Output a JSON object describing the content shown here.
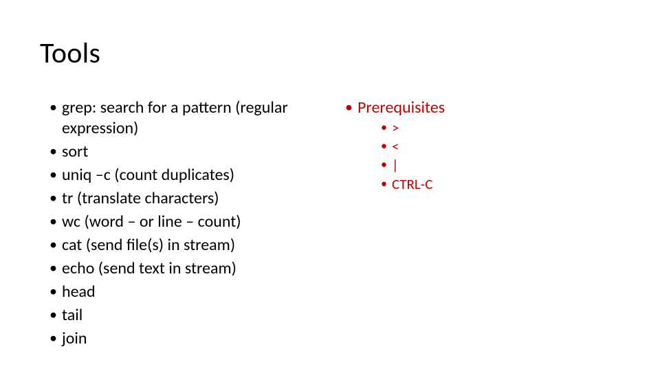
{
  "title": "Tools",
  "left": {
    "items": [
      "grep: search for a pattern (regular expression)",
      "sort",
      "uniq –c (count duplicates)",
      "tr (translate characters)",
      "wc (word – or line – count)",
      "cat (send file(s) in stream)",
      "echo (send text in stream)",
      "head",
      "tail",
      "join"
    ]
  },
  "right": {
    "header": "Prerequisites",
    "items": [
      ">",
      "<",
      "|",
      "CTRL-C"
    ]
  },
  "colors": {
    "accent": "#c00000"
  }
}
